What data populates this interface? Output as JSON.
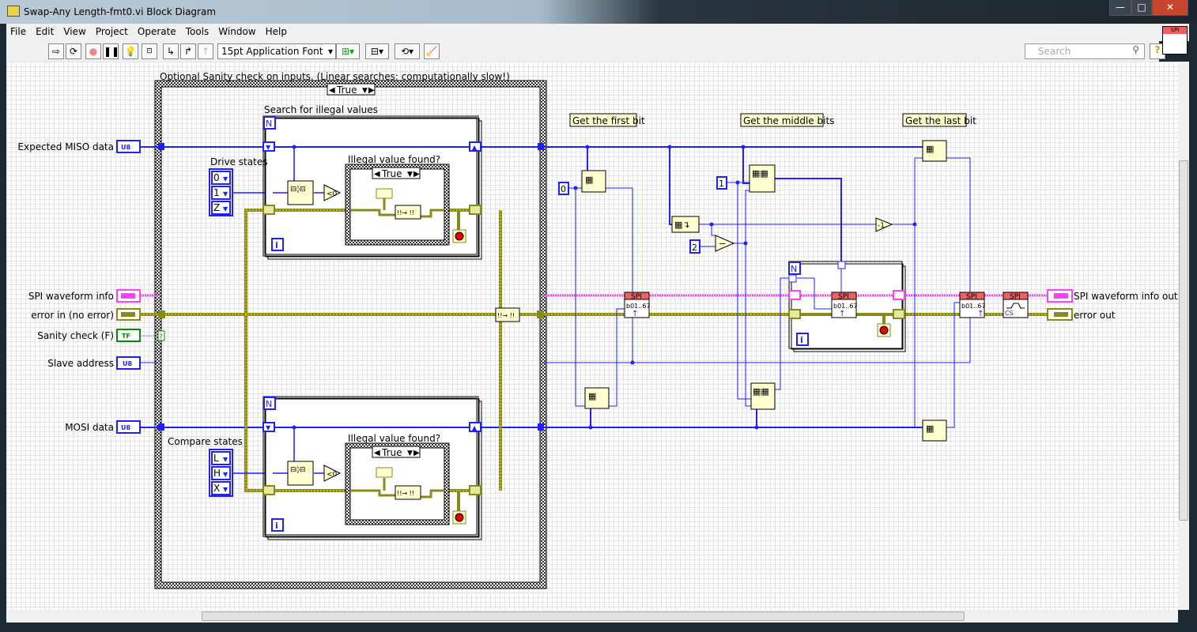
{
  "window": {
    "title": "Swap-Any Length-fmt0.vi Block Diagram",
    "minimize": "—",
    "maximize": "□",
    "close": "✕"
  },
  "menu": [
    "File",
    "Edit",
    "View",
    "Project",
    "Operate",
    "Tools",
    "Window",
    "Help"
  ],
  "toolbar": {
    "font": "15pt Application Font",
    "search_placeholder": "Search",
    "help": "?",
    "connector_label": "SPI"
  },
  "diagram": {
    "case_label": "Optional Sanity check on inputs. (Linear searches: computationally slow!)",
    "case_selector": "True",
    "loop1_label": "Search for illegal values",
    "loop2_label": "",
    "inner_case_label": "Illegal value found?",
    "inner_case_selector": "True",
    "drive_states_label": "Drive states",
    "drive_states": [
      "0",
      "1",
      "Z"
    ],
    "compare_states_label": "Compare states",
    "compare_states": [
      "L",
      "H",
      "X"
    ],
    "loop_index": "i",
    "loop_count": "N",
    "comments": [
      "Get the first bit",
      "Get the middle bits",
      "Get the last bit"
    ],
    "constants": [
      "0",
      "1",
      "2"
    ],
    "decrement": "-1",
    "less_than_zero": "<0",
    "spi_header": "SPI",
    "spi_body": "b01..67",
    "cs_body": "CS"
  },
  "controls": [
    {
      "label": "Expected MISO data",
      "type": "U8",
      "color": "#1f1fff"
    },
    {
      "label": "SPI waveform info",
      "type": "cluster",
      "color": "#ff40ff"
    },
    {
      "label": "error in (no error)",
      "type": "cluster",
      "color": "#8a8a1a"
    },
    {
      "label": "Sanity check (F)",
      "type": "TF",
      "color": "#0a8a0a"
    },
    {
      "label": "Slave address",
      "type": "U8",
      "color": "#1f1fff"
    },
    {
      "label": "MOSI data",
      "type": "U8",
      "color": "#1f1fff"
    }
  ],
  "indicators": [
    {
      "label": "SPI waveform info out",
      "color": "#ff40ff"
    },
    {
      "label": "error out",
      "color": "#8a8a1a"
    }
  ],
  "colors": {
    "numeric_wire": "#1f1fff",
    "error_wire": "#8a8a1a",
    "cluster_wire": "#ff40ff",
    "node_fill": "#ffffd0",
    "spi_header": "#f06060"
  }
}
